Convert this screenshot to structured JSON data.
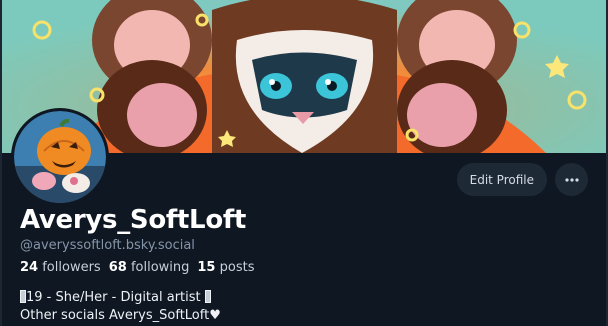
{
  "banner": {
    "description_icon": "fursona-character-banner"
  },
  "avatar": {
    "icon": "pumpkin-avatar"
  },
  "actions": {
    "edit_profile_label": "Edit Profile",
    "more_icon": "more-horizontal-icon"
  },
  "profile": {
    "display_name": "Averys_SoftLoft",
    "handle": "@averyssoftloft.bsky.social",
    "followers_count": "24",
    "followers_label": "followers",
    "following_count": "68",
    "following_label": "following",
    "posts_count": "15",
    "posts_label": "posts",
    "bio_line1": "19 - She/Her - Digital artist",
    "bio_line2": "Other socials Averys_SoftLoft",
    "bio_heart": "♥"
  },
  "colors": {
    "background": "#0f1722",
    "button_bg": "#1e2936",
    "handle_color": "#8595a8"
  }
}
